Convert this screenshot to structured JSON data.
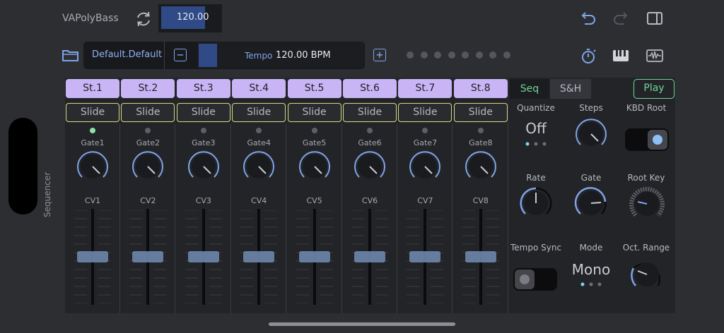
{
  "header": {
    "title": "VAPolyBass",
    "tempo_value": "120.00"
  },
  "preset": {
    "name": "Default.Default",
    "tempo_label": "Tempo",
    "tempo_display": "120.00 BPM"
  },
  "step_dots_count": 8,
  "sequencer": {
    "label": "Sequencer",
    "steps": [
      {
        "step": "St.1",
        "slide": "Slide",
        "gate": "Gate1",
        "cv": "CV1",
        "led_on": true
      },
      {
        "step": "St.2",
        "slide": "Slide",
        "gate": "Gate2",
        "cv": "CV2",
        "led_on": false
      },
      {
        "step": "St.3",
        "slide": "Slide",
        "gate": "Gate3",
        "cv": "CV3",
        "led_on": false
      },
      {
        "step": "St.4",
        "slide": "Slide",
        "gate": "Gate4",
        "cv": "CV4",
        "led_on": false
      },
      {
        "step": "St.5",
        "slide": "Slide",
        "gate": "Gate5",
        "cv": "CV5",
        "led_on": false
      },
      {
        "step": "St.6",
        "slide": "Slide",
        "gate": "Gate6",
        "cv": "CV6",
        "led_on": false
      },
      {
        "step": "St.7",
        "slide": "Slide",
        "gate": "Gate7",
        "cv": "CV7",
        "led_on": false
      },
      {
        "step": "St.8",
        "slide": "Slide",
        "gate": "Gate8",
        "cv": "CV8",
        "led_on": false
      }
    ]
  },
  "panel": {
    "tab_seq": "Seq",
    "tab_sh": "S&H",
    "play": "Play",
    "quantize_label": "Quantize",
    "quantize_value": "Off",
    "steps_label": "Steps",
    "kbd_root_label": "KBD Root",
    "rate_label": "Rate",
    "gate_label": "Gate",
    "root_key_label": "Root Key",
    "tempo_sync_label": "Tempo Sync",
    "mode_label": "Mode",
    "mode_value": "Mono",
    "oct_range_label": "Oct. Range"
  },
  "colors": {
    "accent_blue": "#7fa4ea",
    "step_purple": "#c9b5f5",
    "slide_yellow": "#d6d98a",
    "green": "#6fd89a"
  }
}
